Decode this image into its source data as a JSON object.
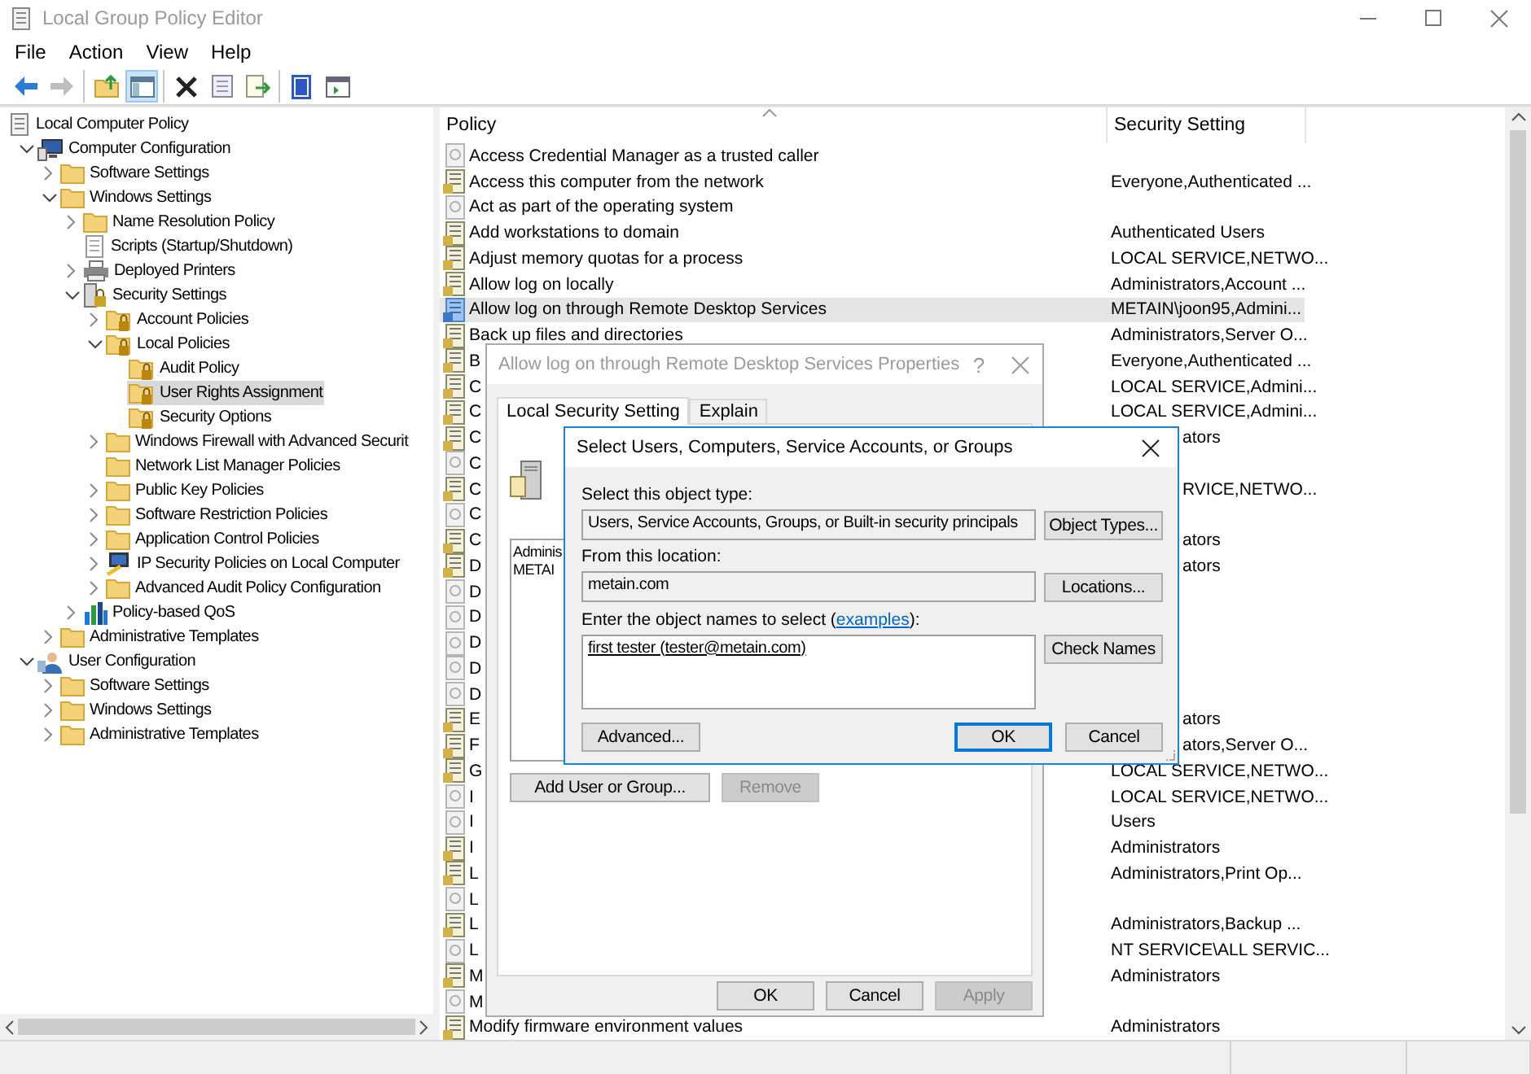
{
  "window": {
    "title": "Local Group Policy Editor"
  },
  "menu": [
    "File",
    "Action",
    "View",
    "Help"
  ],
  "toolbar": [
    [
      {
        "kind": "back",
        "disabled": false,
        "pressed": false
      },
      {
        "kind": "forward",
        "disabled": true,
        "pressed": false
      }
    ],
    [
      {
        "kind": "up",
        "disabled": false,
        "pressed": false
      },
      {
        "kind": "tree",
        "disabled": false,
        "pressed": true
      }
    ],
    [
      {
        "kind": "delete",
        "disabled": false,
        "pressed": false
      },
      {
        "kind": "properties",
        "disabled": false,
        "pressed": false
      },
      {
        "kind": "export",
        "disabled": false,
        "pressed": false
      }
    ],
    [
      {
        "kind": "help",
        "disabled": false,
        "pressed": false
      },
      {
        "kind": "console",
        "disabled": false,
        "pressed": false
      }
    ]
  ],
  "tree": [
    {
      "label": "Local Computer Policy",
      "kind": "policy",
      "selected": false,
      "children": [
        {
          "label": "Computer Configuration",
          "kind": "computer",
          "selected": false,
          "expanded": true,
          "children": [
            {
              "label": "Software Settings",
              "kind": "folder",
              "selected": false,
              "expanded": false
            },
            {
              "label": "Windows Settings",
              "kind": "folder",
              "selected": false,
              "expanded": true,
              "children": [
                {
                  "label": "Name Resolution Policy",
                  "kind": "folder",
                  "selected": false,
                  "expanded": false
                },
                {
                  "label": "Scripts (Startup/Shutdown)",
                  "kind": "script",
                  "selected": false
                },
                {
                  "label": "Deployed Printers",
                  "kind": "printer",
                  "selected": false,
                  "expanded": false
                },
                {
                  "label": "Security Settings",
                  "kind": "security",
                  "selected": false,
                  "expanded": true,
                  "children": [
                    {
                      "label": "Account Policies",
                      "kind": "locked",
                      "selected": false,
                      "expanded": false
                    },
                    {
                      "label": "Local Policies",
                      "kind": "locked",
                      "selected": false,
                      "expanded": true,
                      "children": [
                        {
                          "label": "Audit Policy",
                          "kind": "locked",
                          "selected": false
                        },
                        {
                          "label": "User Rights Assignment",
                          "kind": "locked",
                          "selected": true
                        },
                        {
                          "label": "Security Options",
                          "kind": "locked",
                          "selected": false
                        }
                      ]
                    },
                    {
                      "label": "Windows Firewall with Advanced Securit",
                      "kind": "folder",
                      "selected": false,
                      "expanded": false
                    },
                    {
                      "label": "Network List Manager Policies",
                      "kind": "folder",
                      "selected": false
                    },
                    {
                      "label": "Public Key Policies",
                      "kind": "folder",
                      "selected": false,
                      "expanded": false
                    },
                    {
                      "label": "Software Restriction Policies",
                      "kind": "folder",
                      "selected": false,
                      "expanded": false
                    },
                    {
                      "label": "Application Control Policies",
                      "kind": "folder",
                      "selected": false,
                      "expanded": false
                    },
                    {
                      "label": "IP Security Policies on Local Computer",
                      "kind": "ip",
                      "selected": false,
                      "expanded": false
                    },
                    {
                      "label": "Advanced Audit Policy Configuration",
                      "kind": "folder",
                      "selected": false,
                      "expanded": false
                    }
                  ]
                },
                {
                  "label": "Policy-based QoS",
                  "kind": "chart",
                  "selected": false,
                  "expanded": false
                }
              ]
            },
            {
              "label": "Administrative Templates",
              "kind": "folder",
              "selected": false,
              "expanded": false
            }
          ]
        },
        {
          "label": "User Configuration",
          "kind": "user",
          "selected": false,
          "expanded": true,
          "children": [
            {
              "label": "Software Settings",
              "kind": "folder",
              "selected": false,
              "expanded": false
            },
            {
              "label": "Windows Settings",
              "kind": "folder",
              "selected": false,
              "expanded": false
            },
            {
              "label": "Administrative Templates",
              "kind": "folder",
              "selected": false,
              "expanded": false
            }
          ]
        }
      ]
    }
  ],
  "policy_list": {
    "columns": [
      "Policy",
      "Security Setting"
    ],
    "rows": [
      {
        "policy": "Access Credential Manager as a trusted caller",
        "kind": "blank",
        "selected": false
      },
      {
        "policy": "Access this computer from the network",
        "setting": "Everyone,Authenticated ...",
        "kind": "defined",
        "selected": false
      },
      {
        "policy": "Act as part of the operating system",
        "kind": "blank",
        "selected": false
      },
      {
        "policy": "Add workstations to domain",
        "setting": "Authenticated Users",
        "kind": "defined",
        "selected": false
      },
      {
        "policy": "Adjust memory quotas for a process",
        "setting": "LOCAL SERVICE,NETWO...",
        "kind": "defined",
        "selected": false
      },
      {
        "policy": "Allow log on locally",
        "setting": "Administrators,Account ...",
        "kind": "defined",
        "selected": false
      },
      {
        "policy": "Allow log on through Remote Desktop Services",
        "setting": "METAIN\\joon95,Admini...",
        "kind": "defined",
        "selected": true
      },
      {
        "policy": "Back up files and directories",
        "setting": "Administrators,Server O...",
        "kind": "defined",
        "selected": false
      },
      {
        "policy": "B",
        "setting": "Everyone,Authenticated ...",
        "kind": "defined",
        "selected": false
      },
      {
        "policy": "C",
        "setting": "LOCAL SERVICE,Admini...",
        "kind": "defined",
        "selected": false
      },
      {
        "policy": "C",
        "setting": "LOCAL SERVICE,Admini...",
        "kind": "defined",
        "selected": false
      },
      {
        "policy": "C",
        "setting": "ators",
        "kind": "defined",
        "selected": false
      },
      {
        "policy": "C",
        "kind": "blank",
        "selected": false
      },
      {
        "policy": "C",
        "setting": "RVICE,NETWO...",
        "kind": "defined",
        "selected": false
      },
      {
        "policy": "C",
        "kind": "blank",
        "selected": false
      },
      {
        "policy": "C",
        "setting": "ators",
        "kind": "defined",
        "selected": false
      },
      {
        "policy": "D",
        "setting": "ators",
        "kind": "defined",
        "selected": false
      },
      {
        "policy": "D",
        "kind": "blank",
        "selected": false
      },
      {
        "policy": "D",
        "kind": "blank",
        "selected": false
      },
      {
        "policy": "D",
        "kind": "blank",
        "selected": false
      },
      {
        "policy": "D",
        "kind": "blank",
        "selected": false
      },
      {
        "policy": "D",
        "kind": "blank",
        "selected": false
      },
      {
        "policy": "E",
        "setting": "ators",
        "kind": "defined",
        "selected": false
      },
      {
        "policy": "F",
        "setting": "ators,Server O...",
        "kind": "defined",
        "selected": false
      },
      {
        "policy": "G",
        "setting": "LOCAL SERVICE,NETWO...",
        "kind": "defined",
        "selected": false
      },
      {
        "policy": "I",
        "setting": "LOCAL SERVICE,NETWO...",
        "kind": "blank",
        "selected": false
      },
      {
        "policy": "I",
        "setting": "Users",
        "kind": "blank",
        "selected": false
      },
      {
        "policy": "I",
        "setting": "Administrators",
        "kind": "defined",
        "selected": false
      },
      {
        "policy": "L",
        "setting": "Administrators,Print Op...",
        "kind": "defined",
        "selected": false
      },
      {
        "policy": "L",
        "kind": "blank",
        "selected": false
      },
      {
        "policy": "L",
        "setting": "Administrators,Backup ...",
        "kind": "defined",
        "selected": false
      },
      {
        "policy": "L",
        "setting": "NT SERVICE\\ALL SERVIC...",
        "kind": "blank",
        "selected": false
      },
      {
        "policy": "M",
        "setting": "Administrators",
        "kind": "defined",
        "selected": false
      },
      {
        "policy": "M",
        "kind": "blank",
        "selected": false
      },
      {
        "policy": "Modify firmware environment values",
        "setting": "Administrators",
        "kind": "defined",
        "selected": false
      }
    ]
  },
  "properties_dialog": {
    "title": "Allow log on through Remote Desktop Services Properties",
    "help": "?",
    "tabs": [
      {
        "label": "Local Security Setting",
        "selected": true
      },
      {
        "label": "Explain",
        "selected": false
      }
    ],
    "members": [
      "Adminis",
      "METAI"
    ],
    "buttons": [
      {
        "label": "Add User or Group...",
        "disabled": false
      },
      {
        "label": "Remove",
        "disabled": true
      }
    ],
    "footer_buttons": [
      {
        "label": "OK",
        "disabled": false
      },
      {
        "label": "Cancel",
        "disabled": false
      },
      {
        "label": "Apply",
        "disabled": true
      }
    ]
  },
  "select_dialog": {
    "title": "Select Users, Computers, Service Accounts, or Groups",
    "object_type": {
      "label": "Select this object type:",
      "value": "Users, Service Accounts, Groups, or Built-in security principals",
      "button": "Object Types..."
    },
    "location": {
      "label": "From this location:",
      "value": "metain.com",
      "button": "Locations..."
    },
    "names": {
      "label_before": "Enter the object names to select (",
      "link": "examples",
      "label_after": "):",
      "value": "first tester (tester@metain.com)",
      "button": "Check Names"
    },
    "buttons": [
      {
        "label": "Advanced...",
        "default": false
      },
      {
        "label": "OK",
        "default": true
      },
      {
        "label": "Cancel",
        "default": false
      }
    ]
  }
}
